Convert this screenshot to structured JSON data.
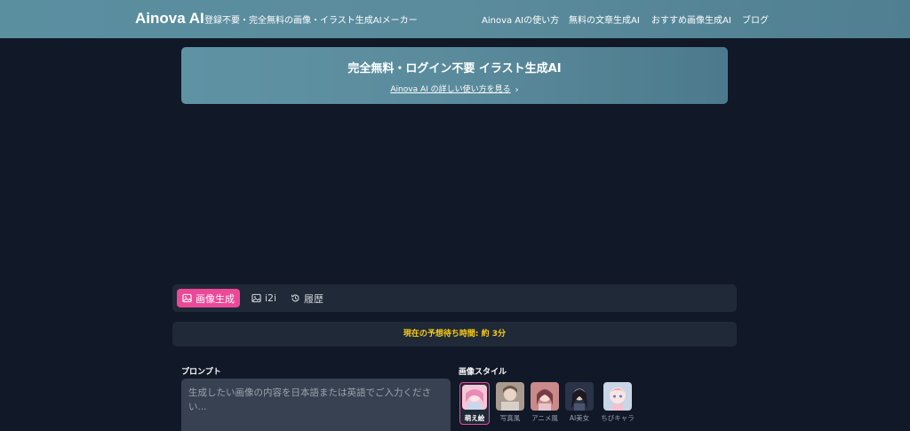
{
  "header": {
    "brand": "Ainova AI",
    "tagline": "登録不要・完全無料の画像・イラスト生成AIメーカー",
    "nav": [
      "Ainova AIの使い方",
      "無料の文章生成AI",
      "おすすめ画像生成AI",
      "ブログ"
    ]
  },
  "banner": {
    "title": "完全無料・ログイン不要 イラスト生成AI",
    "link_text": "Ainova AI の詳しい使い方を見る",
    "link_icon": "chevron-right-icon"
  },
  "tabs": [
    {
      "label": "画像生成",
      "icon": "image-icon",
      "active": true
    },
    {
      "label": "i2i",
      "icon": "image-icon",
      "active": false
    },
    {
      "label": "履歴",
      "icon": "history-icon",
      "active": false
    }
  ],
  "wait_time": "現在の予想待ち時間: 約 3分",
  "prompt": {
    "label": "プロンプト",
    "placeholder": "生成したい画像の内容を日本語または英語でご入力ください..."
  },
  "styles": {
    "label": "画像スタイル",
    "items": [
      {
        "label": "萌え絵",
        "selected": true
      },
      {
        "label": "写真風",
        "selected": false
      },
      {
        "label": "アニメ風",
        "selected": false
      },
      {
        "label": "AI美女",
        "selected": false
      },
      {
        "label": "ちびキャラ",
        "selected": false
      }
    ]
  },
  "colors": {
    "accent": "#ec4899",
    "header": "#5b8c9d",
    "background": "#111827",
    "panel": "#1f2937",
    "wait_text": "#facc15"
  }
}
